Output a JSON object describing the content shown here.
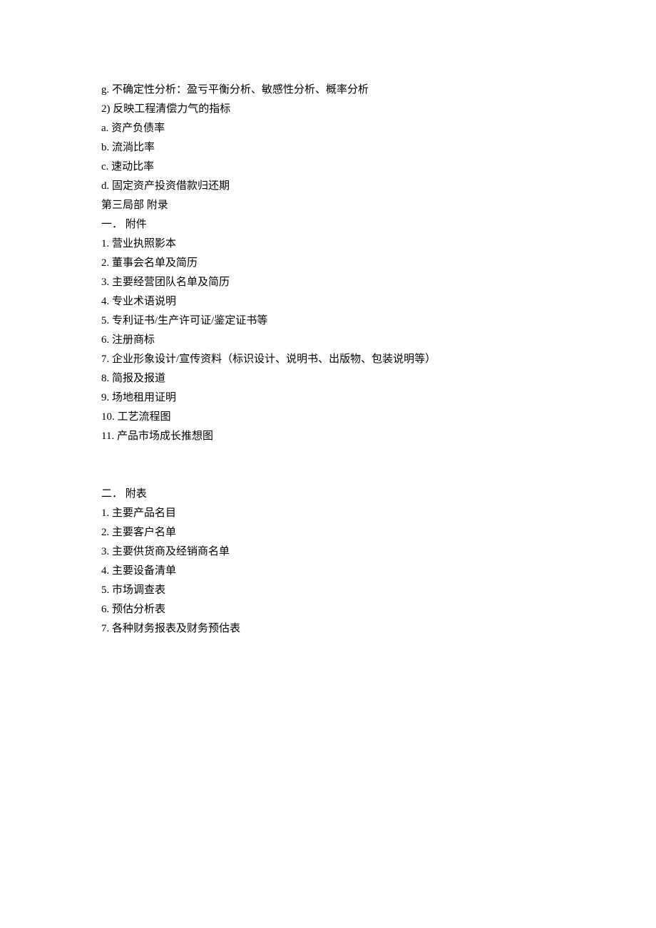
{
  "lines": {
    "l1": "g. 不确定性分析：盈亏平衡分析、敏感性分析、概率分析",
    "l2": "2) 反映工程清偿力气的指标",
    "l3": "a. 资产负债率",
    "l4": "b. 流淌比率",
    "l5": "c. 速动比率",
    "l6": "d. 固定资产投资借款归还期",
    "l7": "第三局部 附录",
    "l8": "一． 附件",
    "l9": "1. 营业执照影本",
    "l10": "2. 董事会名单及简历",
    "l11": "3. 主要经营团队名单及简历",
    "l12": "4. 专业术语说明",
    "l13": "5. 专利证书/生产许可证/鉴定证书等",
    "l14": "6. 注册商标",
    "l15": "7. 企业形象设计/宣传资料（标识设计、说明书、出版物、包装说明等）",
    "l16": "8. 简报及报道",
    "l17": "9. 场地租用证明",
    "l18": "10. 工艺流程图",
    "l19": "11. 产品市场成长推想图",
    "l20": "二． 附表",
    "l21": "1. 主要产品名目",
    "l22": "2. 主要客户名单",
    "l23": "3. 主要供货商及经销商名单",
    "l24": "4. 主要设备清单",
    "l25": "5. 市场调查表",
    "l26": "6. 预估分析表",
    "l27": "7. 各种财务报表及财务预估表"
  }
}
